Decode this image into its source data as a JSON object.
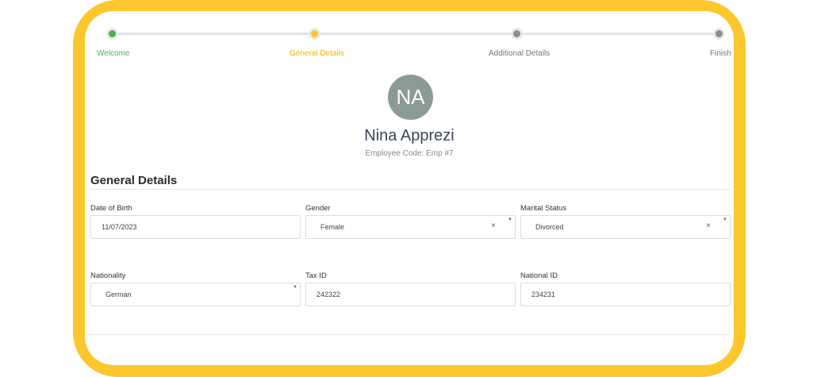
{
  "colors": {
    "frame": "#fcc72c",
    "step_done": "#4caf50",
    "step_current": "#fcc72c",
    "step_pending": "#8d8d8d",
    "avatar_bg": "#8a9b95"
  },
  "stepper": {
    "steps": [
      {
        "label": "Welcome",
        "state": "done"
      },
      {
        "label": "General Details",
        "state": "current"
      },
      {
        "label": "Additional Details",
        "state": "pending"
      },
      {
        "label": "Finish",
        "state": "pending"
      }
    ]
  },
  "profile": {
    "initials": "NA",
    "name": "Nina Apprezi",
    "employee_code": "Employee Code: Emp #7"
  },
  "section": {
    "title": "General Details"
  },
  "fields": {
    "dob": {
      "label": "Date of Birth",
      "value": "11/07/2023"
    },
    "gender": {
      "label": "Gender",
      "value": "Female"
    },
    "marital": {
      "label": "Marital Status",
      "value": "Divorced"
    },
    "nationality": {
      "label": "Nationality",
      "value": "German"
    },
    "tax_id": {
      "label": "Tax ID",
      "value": "242322"
    },
    "national_id": {
      "label": "National ID",
      "value": "234231"
    }
  },
  "icons": {
    "clear": "×",
    "caret": "▼"
  }
}
